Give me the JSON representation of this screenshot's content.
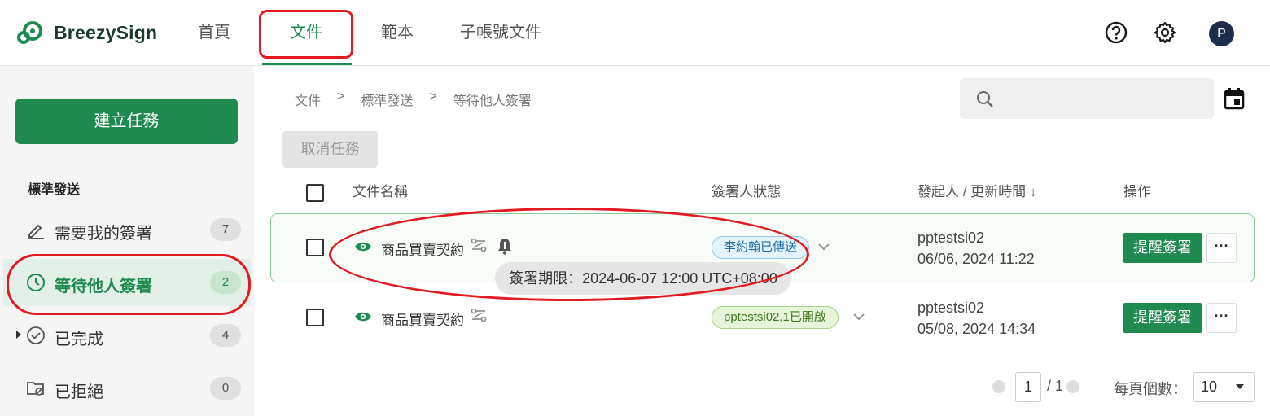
{
  "app": {
    "brand": "BreezySign"
  },
  "nav": {
    "tabs": [
      {
        "label": "首頁"
      },
      {
        "label": "文件"
      },
      {
        "label": "範本"
      },
      {
        "label": "子帳號文件"
      }
    ],
    "avatar": "P"
  },
  "sidebar": {
    "create_button": "建立任務",
    "section_title": "標準發送",
    "items": [
      {
        "label": "需要我的簽署",
        "count": "7"
      },
      {
        "label": "等待他人簽署",
        "count": "2"
      },
      {
        "label": "已完成",
        "count": "4"
      },
      {
        "label": "已拒絕",
        "count": "0"
      }
    ]
  },
  "breadcrumb": [
    "文件",
    "標準發送",
    "等待他人簽署"
  ],
  "breadcrumb_sep": ">",
  "toolbar": {
    "cancel_button": "取消任務"
  },
  "table": {
    "headers": {
      "name": "文件名稱",
      "status": "簽署人狀態",
      "sender": "發起人 / 更新時間 ↓",
      "action": "操作"
    },
    "rows": [
      {
        "name": "商品買賣契約",
        "status": "李約翰已傳送",
        "sender": "pptestsi02",
        "time": "06/06, 2024 11:22",
        "remind": "提醒簽署",
        "more": "···"
      },
      {
        "name": "商品買賣契約",
        "status": "pptestsi02.1已開啟",
        "sender": "pptestsi02",
        "time": "05/08, 2024 14:34",
        "remind": "提醒簽署",
        "more": "···"
      }
    ],
    "tooltip": "簽署期限：2024-06-07 12:00 UTC+08:00"
  },
  "pagination": {
    "current": "1",
    "total": "/ 1",
    "per_page_label": "每頁個數：",
    "per_page": "10"
  },
  "colors": {
    "accent": "#1e8a4f",
    "highlight": "#e21b23"
  }
}
